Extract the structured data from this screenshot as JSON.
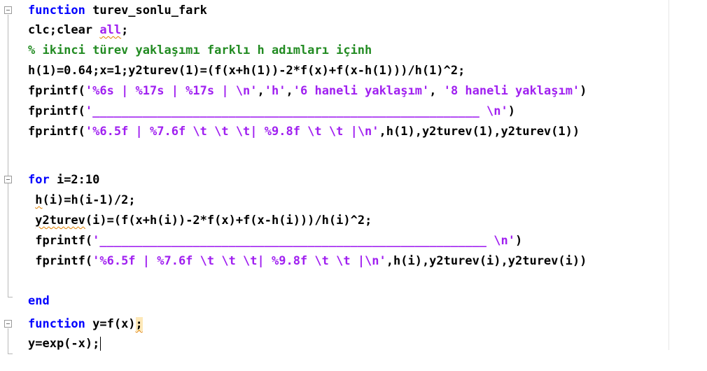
{
  "code": {
    "l1": {
      "kw": "function",
      "rest": " turev_sonlu_fark"
    },
    "l2": {
      "a": "clc;clear ",
      "arg": "all",
      "b": ";"
    },
    "l3": {
      "comment": "% ikinci türev yaklaşımı farklı h adımları içinh"
    },
    "l4": {
      "text": "h(1)=0.64;x=1;y2turev(1)=(f(x+h(1))-2*f(x)+f(x-h(1)))/h(1)^2;"
    },
    "l5": {
      "a": "fprintf(",
      "s1": "'%6s | %17s | %17s | \\n'",
      "b": ",",
      "s2": "'h'",
      "c": ",",
      "s3": "'6 haneli yaklaşım'",
      "d": ", ",
      "s4": "'8 haneli yaklaşım'",
      "e": ")"
    },
    "l6": {
      "a": "fprintf(",
      "s1": "'______________________________________________________ \\n'",
      "b": ")"
    },
    "l7": {
      "a": "fprintf(",
      "s1": "'%6.5f | %7.6f \\t \\t \\t| %9.8f \\t \\t |\\n'",
      "b": ",h(1),y2turev(1),y2turev(1))"
    },
    "l8": {
      "kw": "for",
      "rest": " i=2:10"
    },
    "l9": {
      "a": " ",
      "h": "h",
      "b": "(i)=h(i-1)/2;"
    },
    "l10": {
      "a": " ",
      "v": "y2turev",
      "b": "(i)=(f(x+h(i))-2*f(x)+f(x-h(i)))/h(i)^2;"
    },
    "l11": {
      "a": " fprintf(",
      "s1": "'______________________________________________________ \\n'",
      "b": ")"
    },
    "l12": {
      "a": " fprintf(",
      "s1": "'%6.5f | %7.6f \\t \\t \\t| %9.8f \\t \\t |\\n'",
      "b": ",h(i),y2turev(i),y2turev(i))"
    },
    "l13": {
      "kw": "end"
    },
    "l14": {
      "kw": "function",
      "rest": " y=f(x)",
      "semi": ";"
    },
    "l15": {
      "text": "y=exp(-x);"
    }
  }
}
